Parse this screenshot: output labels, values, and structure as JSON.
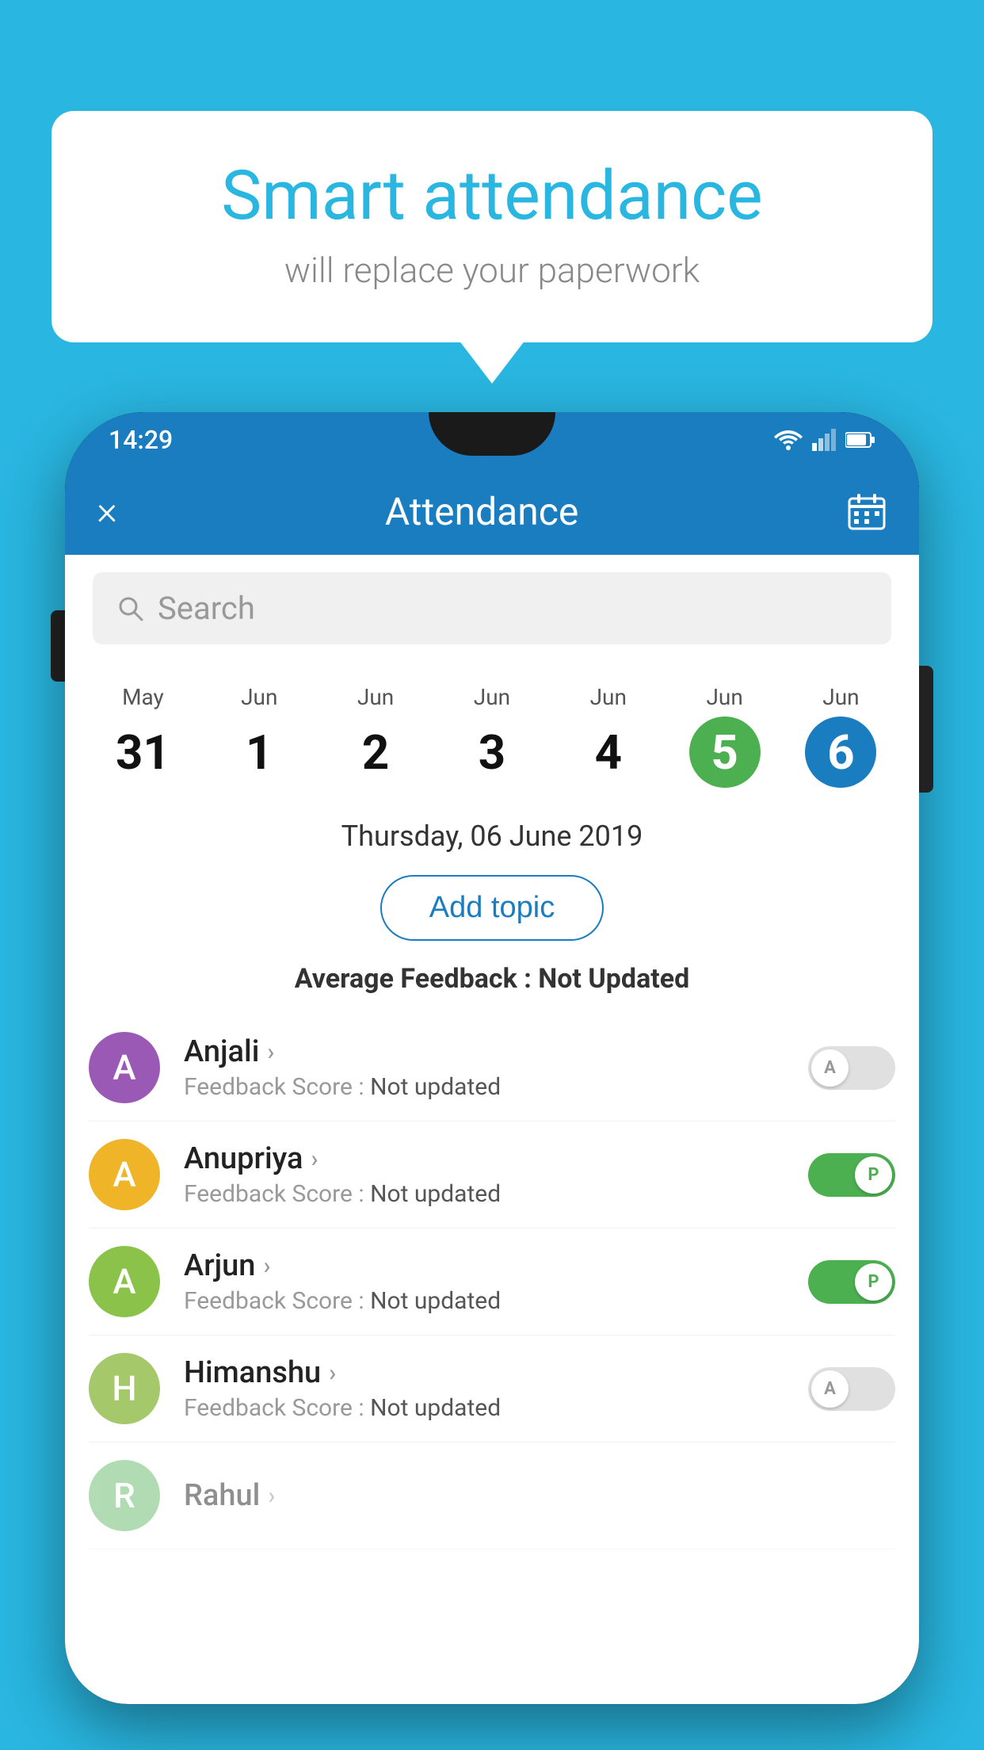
{
  "background_color": "#29B6E0",
  "speech_bubble": {
    "title": "Smart attendance",
    "subtitle": "will replace your paperwork"
  },
  "phone": {
    "status_bar": {
      "time": "14:29"
    },
    "app_bar": {
      "close_label": "×",
      "title": "Attendance",
      "calendar_icon": "calendar-icon"
    },
    "search": {
      "placeholder": "Search"
    },
    "dates": [
      {
        "month": "May",
        "day": "31",
        "state": "normal"
      },
      {
        "month": "Jun",
        "day": "1",
        "state": "normal"
      },
      {
        "month": "Jun",
        "day": "2",
        "state": "normal"
      },
      {
        "month": "Jun",
        "day": "3",
        "state": "normal"
      },
      {
        "month": "Jun",
        "day": "4",
        "state": "normal"
      },
      {
        "month": "Jun",
        "day": "5",
        "state": "today"
      },
      {
        "month": "Jun",
        "day": "6",
        "state": "selected"
      }
    ],
    "selected_date_label": "Thursday, 06 June 2019",
    "add_topic_label": "Add topic",
    "avg_feedback_label": "Average Feedback :",
    "avg_feedback_value": "Not Updated",
    "students": [
      {
        "name": "Anjali",
        "avatar_letter": "A",
        "avatar_color": "#9B59B6",
        "feedback_label": "Feedback Score :",
        "feedback_value": "Not updated",
        "toggle": "off",
        "toggle_label": "A"
      },
      {
        "name": "Anupriya",
        "avatar_letter": "A",
        "avatar_color": "#F0B429",
        "feedback_label": "Feedback Score :",
        "feedback_value": "Not updated",
        "toggle": "on",
        "toggle_label": "P"
      },
      {
        "name": "Arjun",
        "avatar_letter": "A",
        "avatar_color": "#8BC34A",
        "feedback_label": "Feedback Score :",
        "feedback_value": "Not updated",
        "toggle": "on",
        "toggle_label": "P"
      },
      {
        "name": "Himanshu",
        "avatar_letter": "H",
        "avatar_color": "#A5C86B",
        "feedback_label": "Feedback Score :",
        "feedback_value": "Not updated",
        "toggle": "off",
        "toggle_label": "A"
      }
    ]
  }
}
